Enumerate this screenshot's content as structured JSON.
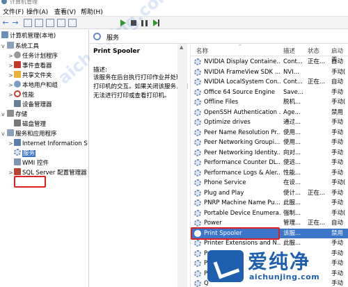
{
  "title_bar": {
    "title": "计算机管理"
  },
  "menu": [
    "文件(F)",
    "操作(A)",
    "查看(V)",
    "帮助(H)"
  ],
  "toolbar": {
    "icons": [
      "back-arrow",
      "forward-arrow",
      "console-tree",
      "properties",
      "help",
      "export",
      "show-hide",
      "start",
      "stop",
      "pause",
      "restart"
    ]
  },
  "tree": [
    {
      "label": "计算机管理(本地)",
      "level": 0,
      "expander": "",
      "icon": "computer"
    },
    {
      "label": "系统工具",
      "level": 1,
      "expander": "v",
      "icon": "tools"
    },
    {
      "label": "任务计划程序",
      "level": 2,
      "expander": ">",
      "icon": "clock"
    },
    {
      "label": "事件查看器",
      "level": 2,
      "expander": ">",
      "icon": "event"
    },
    {
      "label": "共享文件夹",
      "level": 2,
      "expander": ">",
      "icon": "folder"
    },
    {
      "label": "本地用户和组",
      "level": 2,
      "expander": ">",
      "icon": "users"
    },
    {
      "label": "性能",
      "level": 2,
      "expander": ">",
      "icon": "perf"
    },
    {
      "label": "设备管理器",
      "level": 2,
      "expander": "",
      "icon": "device"
    },
    {
      "label": "存储",
      "level": 1,
      "expander": "v",
      "icon": "storage"
    },
    {
      "label": "磁盘管理",
      "level": 2,
      "expander": "",
      "icon": "disk"
    },
    {
      "label": "服务和应用程序",
      "level": 1,
      "expander": "v",
      "icon": "apps"
    },
    {
      "label": "Internet Information S",
      "level": 2,
      "expander": ">",
      "icon": "iis"
    },
    {
      "label": "服务",
      "level": 2,
      "expander": "",
      "icon": "services",
      "selected": true
    },
    {
      "label": "WMI 控件",
      "level": 2,
      "expander": "",
      "icon": "wmi"
    },
    {
      "label": "SQL Server 配置管理器",
      "level": 2,
      "expander": ">",
      "icon": "sql"
    }
  ],
  "services_panel": {
    "title": "服务"
  },
  "description": {
    "service_name": "Print Spooler",
    "label": "描述:",
    "text": "该服务在后台执行打印作业并处理与打印机的交互。如果关闭该服务，则无法进行打印或查看打印机。"
  },
  "table": {
    "headers": [
      "名称",
      "描述",
      "状态",
      "启动类"
    ],
    "rows": [
      [
        "NVIDIA Display Containe...",
        "Cont...",
        "正在...",
        "自动"
      ],
      [
        "NVIDIA FrameView SDK ...",
        "NVI...",
        "",
        "手动("
      ],
      [
        "NVIDIA LocalSystem Con...",
        "Cont...",
        "正在...",
        "自动"
      ],
      [
        "Office 64 Source Engine",
        "Save...",
        "",
        "手动"
      ],
      [
        "Offline Files",
        "脱机...",
        "",
        "手动("
      ],
      [
        "OpenSSH Authentication ...",
        "Age...",
        "",
        "禁用"
      ],
      [
        "Optimize drives",
        "通过...",
        "",
        "手动"
      ],
      [
        "Peer Name Resolution Pr...",
        "使用...",
        "",
        "手动"
      ],
      [
        "Peer Networking Groupi...",
        "使用...",
        "",
        "手动"
      ],
      [
        "Peer Networking Identity...",
        "向对...",
        "",
        "手动"
      ],
      [
        "Performance Counter DL...",
        "使远...",
        "",
        "手动"
      ],
      [
        "Performance Logs & Aler...",
        "性能...",
        "",
        "手动"
      ],
      [
        "Phone Service",
        "在设...",
        "",
        "手动("
      ],
      [
        "Plug and Play",
        "使计...",
        "正在...",
        "手动"
      ],
      [
        "PNRP Machine Name Pu...",
        "此服...",
        "",
        "手动"
      ],
      [
        "Portable Device Enumera...",
        "强制...",
        "",
        "手动("
      ],
      [
        "Power",
        "管理...",
        "正在...",
        "自动"
      ],
      [
        "Print Spooler",
        "该服...",
        "",
        "禁用"
      ],
      [
        "Printer Extensions and N...",
        "此服...",
        "",
        "手动"
      ],
      [
        "Pr",
        "",
        "",
        "手动"
      ],
      [
        "Pr",
        "",
        "",
        "手动"
      ],
      [
        "Pr",
        "",
        "",
        "手动"
      ],
      [
        "Q",
        "",
        "",
        "手动"
      ]
    ],
    "selected_row": 17
  },
  "watermark": {
    "chinese": "爱纯净",
    "url": "aichunjing.com"
  },
  "colors": {
    "selection": "#3b76c8",
    "highlight_box": "#e02020",
    "watermark": "#1f5fb0"
  }
}
